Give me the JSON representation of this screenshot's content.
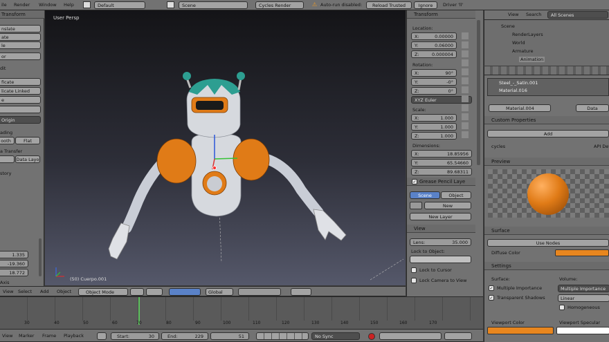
{
  "topbar": {
    "menus": [
      "ile",
      "Render",
      "Window",
      "Help"
    ],
    "layout": "Default",
    "scene": "Scene",
    "engine": "Cycles Render",
    "warning": "Auto-run disabled:",
    "reload": "Reload Trusted",
    "ignore": "Ignore",
    "driver": "Driver 'll'"
  },
  "toolshelf": {
    "title": "Transform",
    "items": [
      "nslate",
      "ate",
      "le",
      "or",
      "dit",
      "ficate",
      "licate Linked",
      "e",
      "Origin",
      "ading",
      "ooth",
      "Flat",
      "a Transfer",
      "Data Layo",
      "story"
    ],
    "values": [
      "1.335",
      "-19.360",
      "18.772"
    ],
    "footer": "Axis"
  },
  "viewport": {
    "label": "User Persp",
    "object_label": "(50) Cuerpo.001",
    "menus": [
      "View",
      "Select",
      "Add",
      "Object"
    ],
    "mode": "Object Mode",
    "orientation": "Global"
  },
  "npanel": {
    "transform_title": "Transform",
    "location_label": "Location:",
    "location": [
      {
        "axis": "X:",
        "value": "0.00000"
      },
      {
        "axis": "Y:",
        "value": "0.06000"
      },
      {
        "axis": "Z:",
        "value": "0.000004"
      }
    ],
    "rotation_label": "Rotation:",
    "rotation": [
      {
        "axis": "X:",
        "value": "90°"
      },
      {
        "axis": "Y:",
        "value": "-0°"
      },
      {
        "axis": "Z:",
        "value": "0°"
      }
    ],
    "rot_mode": "XYZ Euler",
    "scale_label": "Scale:",
    "scale": [
      {
        "axis": "X:",
        "value": "1.000"
      },
      {
        "axis": "Y:",
        "value": "1.000"
      },
      {
        "axis": "Z:",
        "value": "1.000"
      }
    ],
    "dim_label": "Dimensions:",
    "dimensions": [
      {
        "axis": "X:",
        "value": "18.85956"
      },
      {
        "axis": "Y:",
        "value": "65.54660"
      },
      {
        "axis": "Z:",
        "value": "89.68311"
      }
    ],
    "gp_label": "Grease Pencil Laye",
    "scene_tab": "Scene",
    "object_tab": "Object",
    "new": "New",
    "new_layer": "New Layer",
    "view_title": "View",
    "lens_label": "Lens:",
    "lens": "35.000",
    "lock_label": "Lock to Object:",
    "lock_cursor": "Lock to Cursor",
    "lock_camera": "Lock Camera to View"
  },
  "outliner": {
    "menus": [
      "View",
      "Search"
    ],
    "filter": "All Scenes",
    "items": [
      "Scene",
      "RenderLayers",
      "World",
      "Armature",
      "Animation"
    ]
  },
  "props": {
    "materials": [
      "Steel_-_Satin.001",
      "Material.016"
    ],
    "material_name": "Material.004",
    "data_btn": "Data",
    "custom_title": "Custom Properties",
    "add_btn": "Add",
    "cycles_label": "cycles",
    "api_label": "API Def",
    "preview_title": "Preview",
    "surface_title": "Surface",
    "use_nodes": "Use Nodes",
    "diffuse_label": "Diffuse Color",
    "diffuse_color": "#e8861e",
    "settings_title": "Settings",
    "surface_label": "Surface:",
    "volume_label": "Volume:",
    "mult_imp": "Multiple Importance",
    "transp": "Transparent Shadows",
    "vol_sel": "Multiple Importance",
    "linear": "Linear",
    "homogeneous": "Homogeneous",
    "vp_color": "Viewport Color",
    "vp_spec": "Viewport Specular",
    "vp_color_val": "#e8861e"
  },
  "timeline": {
    "ticks": [
      "30",
      "40",
      "50",
      "60",
      "70",
      "80",
      "90",
      "100",
      "110",
      "120",
      "130",
      "140",
      "150",
      "160",
      "170"
    ],
    "menus": [
      "View",
      "Marker",
      "Frame",
      "Playback"
    ],
    "start_label": "Start:",
    "start": "30",
    "end_label": "End:",
    "end": "229",
    "current": "51",
    "sync": "No Sync"
  }
}
